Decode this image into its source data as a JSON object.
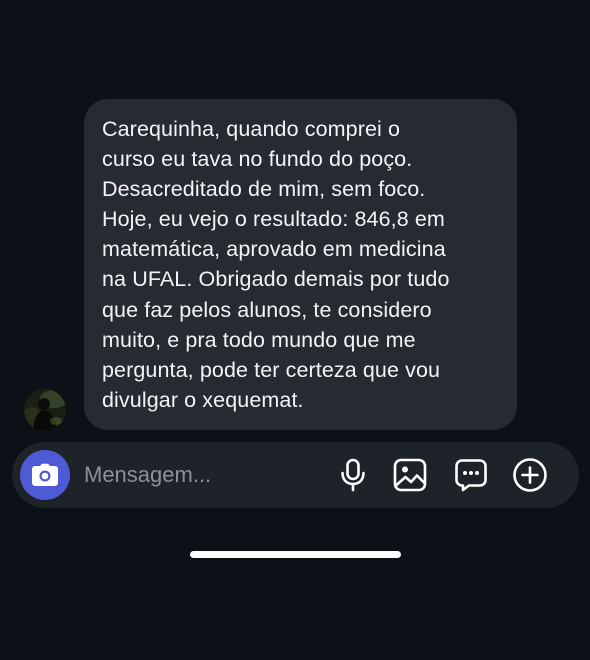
{
  "conversation": {
    "message": {
      "text": "Carequinha, quando comprei o\ncurso eu tava no fundo do poço.\nDesacreditado de mim, sem foco.\nHoje, eu vejo o resultado: 846,8 em\nmatemática, aprovado em medicina\nna UFAL. Obrigado demais por tudo\nque faz pelos alunos, te considero\nmuito, e pra todo mundo que me\npergunta, pode ter certeza que vou\ndivulgar o xequemat."
    }
  },
  "composer": {
    "placeholder": "Mensagem...",
    "icons": {
      "camera": "camera-icon",
      "mic": "microphone-icon",
      "gallery": "image-icon",
      "sticker": "message-dots-icon",
      "plus": "plus-circle-icon"
    }
  },
  "colors": {
    "background": "#0c1017",
    "bubble": "#262a31",
    "composer": "#1e2229",
    "camera_accent": "#4f5bd5",
    "text": "#f3f4f6",
    "placeholder": "#8c9098"
  }
}
